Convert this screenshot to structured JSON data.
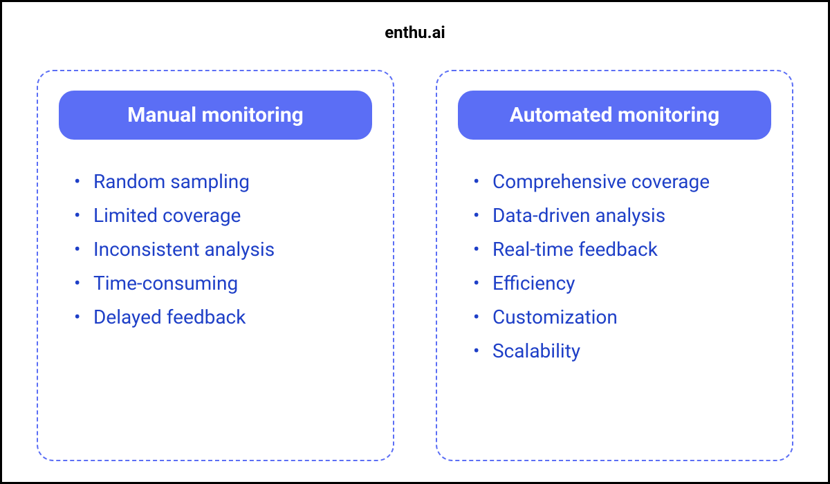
{
  "title": "enthu.ai",
  "cards": [
    {
      "header": "Manual monitoring",
      "items": [
        "Random sampling",
        "Limited coverage",
        "Inconsistent analysis",
        "Time-consuming",
        "Delayed feedback"
      ]
    },
    {
      "header": "Automated monitoring",
      "items": [
        "Comprehensive coverage",
        "Data-driven analysis",
        "Real-time feedback",
        "Efficiency",
        "Customization",
        "Scalability"
      ]
    }
  ],
  "colors": {
    "accent": "#5B6EF5",
    "text": "#1E3FC7",
    "border": "#000000"
  }
}
